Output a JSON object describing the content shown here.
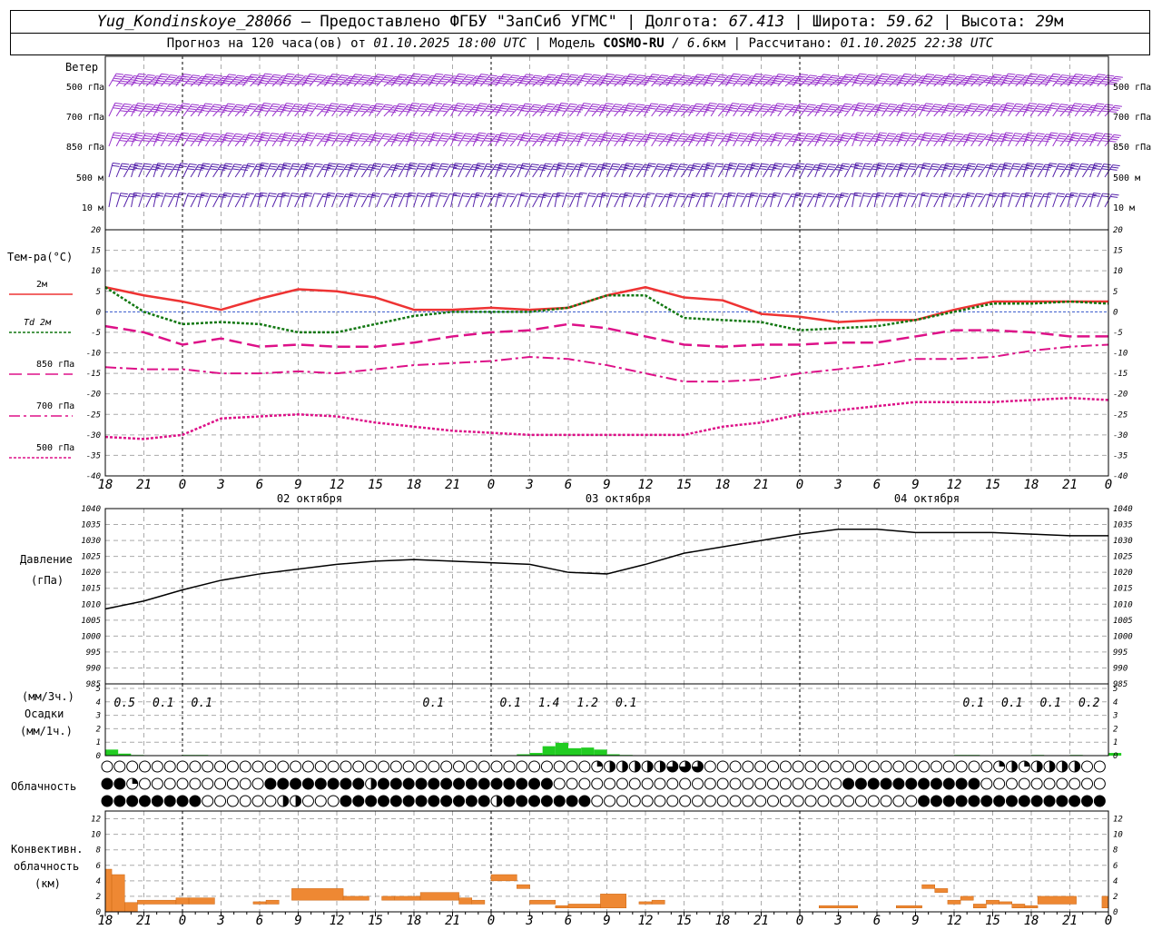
{
  "header": {
    "station": "Yug_Kondinskoye_28066",
    "provided_by": "– Предоставлено ФГБУ \"ЗапСиб УГМС\"",
    "lon_label": "Долгота:",
    "lon_value": "67.413",
    "lat_label": "Широта:",
    "lat_value": "59.62",
    "alt_label": "Высота:",
    "alt_value": "29",
    "alt_unit": "м",
    "forecast_label": "Прогноз на 120 часа(ов) от",
    "forecast_start": "01.10.2025 18:00 UTC",
    "model_label": "Модель",
    "model_name": "COSMO-RU",
    "model_res": "/ 6.6",
    "model_res_unit": "км",
    "calc_label": "Рассчитано:",
    "calc_time": "01.10.2025 22:38 UTC"
  },
  "labels": {
    "wind_title": "Ветер",
    "wind_levels": [
      "500 гПа",
      "700 гПа",
      "850 гПа",
      "500 м",
      "10 м"
    ],
    "temp_title": "Тем-ра(°C)",
    "temp_legend": [
      "2м",
      "Td 2м",
      "850 гПа",
      "700 гПа",
      "500 гПа"
    ],
    "pressure_title": [
      "Давление",
      "(гПа)"
    ],
    "precip_title": [
      "(мм/3ч.)",
      "Осадки",
      "(мм/1ч.)"
    ],
    "cloud_title": "Облачность",
    "conv_title": [
      "Конвективн.",
      "облачность",
      "(км)"
    ]
  },
  "time_axis": {
    "hour_labels": [
      "18",
      "21",
      "0",
      "3",
      "6",
      "9",
      "12",
      "15",
      "18",
      "21",
      "0",
      "3",
      "6",
      "9",
      "12",
      "15",
      "18",
      "21",
      "0",
      "3",
      "6",
      "9",
      "12",
      "15",
      "18",
      "21",
      "0"
    ],
    "date_labels": [
      "02 октября",
      "03 октября",
      "04 октября"
    ]
  },
  "chart_data": [
    {
      "type": "line",
      "title": "Тем-ра(°C)",
      "ylim": [
        -40,
        20
      ],
      "yticks": [
        20,
        15,
        10,
        5,
        0,
        -5,
        -10,
        -15,
        -20,
        -25,
        -30,
        -35,
        -40
      ],
      "x_hours": [
        0,
        3,
        6,
        9,
        12,
        15,
        18,
        21,
        24,
        27,
        30,
        33,
        36,
        39,
        42,
        45,
        48,
        51,
        54,
        57,
        60,
        63,
        66,
        69,
        72,
        75,
        78
      ],
      "series": [
        {
          "name": "2м",
          "color": "#ee3333",
          "values": [
            6,
            4,
            2.5,
            0.5,
            3.2,
            5.5,
            5,
            3.5,
            0.5,
            0.5,
            1,
            0.5,
            1,
            4,
            6,
            3.5,
            2.8,
            -0.5,
            -1.2,
            -2.5,
            -2,
            -2,
            0.5,
            2.5,
            2.5,
            2.5,
            2.5
          ]
        },
        {
          "name": "Td 2м",
          "color": "#117711",
          "values": [
            6,
            0,
            -3,
            -2.5,
            -3,
            -5,
            -5,
            -3,
            -1,
            0,
            0,
            0,
            1,
            4,
            4,
            -1.5,
            -2,
            -2.5,
            -4.5,
            -4,
            -3.5,
            -2,
            0,
            2,
            2,
            2.5,
            2
          ]
        },
        {
          "name": "850 гПа",
          "color": "#dd1188",
          "values": [
            -3.5,
            -5,
            -8,
            -6.5,
            -8.5,
            -8,
            -8.5,
            -8.5,
            -7.5,
            -6,
            -5,
            -4.5,
            -3,
            -4,
            -6,
            -8,
            -8.5,
            -8,
            -8,
            -7.5,
            -7.5,
            -6,
            -4.5,
            -4.5,
            -5,
            -6,
            -6
          ]
        },
        {
          "name": "700 гПа",
          "color": "#dd1188",
          "values": [
            -13.5,
            -14,
            -14,
            -15,
            -15,
            -14.5,
            -15,
            -14,
            -13,
            -12.5,
            -12,
            -11,
            -11.5,
            -13,
            -15,
            -17,
            -17,
            -16.5,
            -15,
            -14,
            -13,
            -11.5,
            -11.5,
            -11,
            -9.5,
            -8.5,
            -8
          ]
        },
        {
          "name": "500 гПа",
          "color": "#dd1188",
          "values": [
            -30.5,
            -31,
            -30,
            -26,
            -25.5,
            -25,
            -25.5,
            -27,
            -28,
            -29,
            -29.5,
            -30,
            -30,
            -30,
            -30,
            -30,
            -28,
            -27,
            -25,
            -24,
            -23,
            -22,
            -22,
            -22,
            -21.5,
            -21,
            -21.5
          ]
        }
      ]
    },
    {
      "type": "line",
      "title": "Давление (гПа)",
      "ylim": [
        985,
        1040
      ],
      "yticks": [
        1040,
        1035,
        1030,
        1025,
        1020,
        1015,
        1010,
        1005,
        1000,
        995,
        990,
        985
      ],
      "x_hours": [
        0,
        3,
        6,
        9,
        12,
        15,
        18,
        21,
        24,
        27,
        30,
        33,
        36,
        39,
        42,
        45,
        48,
        51,
        54,
        57,
        60,
        63,
        66,
        69,
        72,
        75,
        78
      ],
      "series": [
        {
          "name": "Давление",
          "color": "#000000",
          "values": [
            1008.5,
            1011,
            1014.5,
            1017.5,
            1019.5,
            1021,
            1022.5,
            1023.5,
            1024,
            1023.5,
            1023,
            1022.5,
            1020,
            1019.5,
            1022.5,
            1026,
            1028,
            1030,
            1032,
            1033.5,
            1033.5,
            1032.5,
            1032.5,
            1032.5,
            1032,
            1031.5,
            1031.5
          ]
        }
      ]
    },
    {
      "type": "bar",
      "title": "Осадки",
      "ylim": [
        0,
        5
      ],
      "yticks": [
        5,
        4,
        3,
        2,
        1,
        0
      ],
      "values_3h_labels": [
        {
          "hour": 1.5,
          "value": "0.5"
        },
        {
          "hour": 4.5,
          "value": "0.1"
        },
        {
          "hour": 7.5,
          "value": "0.1"
        },
        {
          "hour": 25.5,
          "value": "0.1"
        },
        {
          "hour": 31.5,
          "value": "0.1"
        },
        {
          "hour": 34.5,
          "value": "1.4"
        },
        {
          "hour": 37.5,
          "value": "1.2"
        },
        {
          "hour": 40.5,
          "value": "0.1"
        },
        {
          "hour": 67.5,
          "value": "0.1"
        },
        {
          "hour": 70.5,
          "value": "0.1"
        },
        {
          "hour": 73.5,
          "value": "0.1"
        },
        {
          "hour": 76.5,
          "value": "0.2"
        }
      ],
      "hourly": [
        {
          "hour": 0,
          "value": 0.45
        },
        {
          "hour": 1,
          "value": 0.15
        },
        {
          "hour": 2,
          "value": 0.05
        },
        {
          "hour": 6,
          "value": 0.05
        },
        {
          "hour": 7,
          "value": 0.05
        },
        {
          "hour": 32,
          "value": 0.1
        },
        {
          "hour": 33,
          "value": 0.2
        },
        {
          "hour": 34,
          "value": 0.7
        },
        {
          "hour": 35,
          "value": 0.95
        },
        {
          "hour": 36,
          "value": 0.55
        },
        {
          "hour": 37,
          "value": 0.6
        },
        {
          "hour": 38,
          "value": 0.45
        },
        {
          "hour": 39,
          "value": 0.1
        },
        {
          "hour": 40,
          "value": 0.05
        },
        {
          "hour": 66,
          "value": 0.05
        },
        {
          "hour": 67,
          "value": 0.05
        },
        {
          "hour": 72,
          "value": 0.05
        },
        {
          "hour": 75,
          "value": 0.05
        },
        {
          "hour": 78,
          "value": 0.2
        }
      ]
    },
    {
      "type": "bar",
      "title": "Конвективн. облачность (км)",
      "ylim": [
        0,
        13
      ],
      "yticks": [
        12,
        10,
        8,
        6,
        4,
        2,
        0
      ],
      "segments": [
        {
          "from": 0,
          "to": 0.5,
          "base": 0,
          "top": 5.5
        },
        {
          "from": 0.5,
          "to": 1.5,
          "base": 0,
          "top": 4.8
        },
        {
          "from": 1.5,
          "to": 2.5,
          "base": 0,
          "top": 1.2
        },
        {
          "from": 2.5,
          "to": 5.5,
          "base": 1.0,
          "top": 1.5
        },
        {
          "from": 5.5,
          "to": 6.5,
          "base": 1.0,
          "top": 1.8
        },
        {
          "from": 6.5,
          "to": 8.5,
          "base": 1.0,
          "top": 1.8
        },
        {
          "from": 11.5,
          "to": 12.5,
          "base": 1.0,
          "top": 1.3
        },
        {
          "from": 12.5,
          "to": 13.5,
          "base": 1.0,
          "top": 1.5
        },
        {
          "from": 14.5,
          "to": 18.5,
          "base": 1.5,
          "top": 3.0
        },
        {
          "from": 18.5,
          "to": 20.5,
          "base": 1.5,
          "top": 2.0
        },
        {
          "from": 21.5,
          "to": 22.5,
          "base": 1.5,
          "top": 2.0
        },
        {
          "from": 22.5,
          "to": 24.5,
          "base": 1.5,
          "top": 2.0
        },
        {
          "from": 24.5,
          "to": 27.5,
          "base": 1.5,
          "top": 2.5
        },
        {
          "from": 27.5,
          "to": 28.5,
          "base": 1.0,
          "top": 1.8
        },
        {
          "from": 28.5,
          "to": 29.5,
          "base": 1.0,
          "top": 1.5
        },
        {
          "from": 30,
          "to": 32,
          "base": 4.0,
          "top": 4.8
        },
        {
          "from": 32,
          "to": 33,
          "base": 3.0,
          "top": 3.5
        },
        {
          "from": 33,
          "to": 35,
          "base": 1.0,
          "top": 1.5
        },
        {
          "from": 35,
          "to": 36,
          "base": 0.5,
          "top": 0.8
        },
        {
          "from": 36,
          "to": 38.5,
          "base": 0.5,
          "top": 1.0
        },
        {
          "from": 38.5,
          "to": 40.5,
          "base": 0.5,
          "top": 2.3
        },
        {
          "from": 41.5,
          "to": 42.5,
          "base": 1.0,
          "top": 1.3
        },
        {
          "from": 42.5,
          "to": 43.5,
          "base": 1.0,
          "top": 1.5
        },
        {
          "from": 55.5,
          "to": 58.5,
          "base": 0.5,
          "top": 0.8
        },
        {
          "from": 61.5,
          "to": 63.5,
          "base": 0.5,
          "top": 0.8
        },
        {
          "from": 63.5,
          "to": 64.5,
          "base": 3.0,
          "top": 3.5
        },
        {
          "from": 64.5,
          "to": 65.5,
          "base": 2.5,
          "top": 3.0
        },
        {
          "from": 65.5,
          "to": 66.5,
          "base": 1.0,
          "top": 1.5
        },
        {
          "from": 66.5,
          "to": 67.5,
          "base": 1.5,
          "top": 2.0
        },
        {
          "from": 67.5,
          "to": 68.5,
          "base": 0.5,
          "top": 1.0
        },
        {
          "from": 68.5,
          "to": 69.5,
          "base": 1.0,
          "top": 1.5
        },
        {
          "from": 69.5,
          "to": 70.5,
          "base": 1.0,
          "top": 1.3
        },
        {
          "from": 70.5,
          "to": 71.5,
          "base": 0.5,
          "top": 1.0
        },
        {
          "from": 71.5,
          "to": 72.5,
          "base": 0.5,
          "top": 0.8
        },
        {
          "from": 72.5,
          "to": 75.5,
          "base": 1.0,
          "top": 2.0
        },
        {
          "from": 77.5,
          "to": 78,
          "base": 0.5,
          "top": 2.0
        }
      ]
    }
  ],
  "cloudiness": {
    "rows": [
      "OOOOOOOOOOOOOOOOOOOOOOOOOOOOOOOOOOOOOOOOOOOOOOOOOOOOOOOOOOOOOOOOOOOOOOOOOOOOOOOOOOOOOOOOOOOOOOOQHHHHHHHHQHHHTTTTTTTTOOOOOOOOOOOOOOOOOOOOOOOOOOOOOOOOOOOOOOOOOOOOOOOOOOOOOOOOOQHHHHQHHHHHHHHHHQOOOOOO",
      "FFQQOOOOOOOOOOOOOOOOOFFFFFFFFFFFFFFFHFFFFFFFFFFFFFFFFFFFFFFFFOOOOOOOOOOOOOOOOOOOOOOOOOOOOOOOOOOOOOOOOFFFFFFFFFFFFFHFFFFFOOOOOOOOOOOOOOOOOO",
      "FFFFFFFFFFFOOOOOOOOOOHHHOOOOOFFFFFFFFFFFFFFFFFFFHFFFFFFFFFFOOOOOOOOOOOOOOOOOOOOOOOOOOOOOOOOOOOOOOOOOFFFFFFFFFFFFFFFFFFHFFFFF"
    ]
  },
  "colors": {
    "wind": "#9933cc",
    "wind_low": "#5522aa",
    "grid": "#aaaaaa",
    "t2m": "#ee3333",
    "td": "#117711",
    "upper": "#dd1188",
    "precip": "#22cc22",
    "conv": "#ee8833"
  }
}
